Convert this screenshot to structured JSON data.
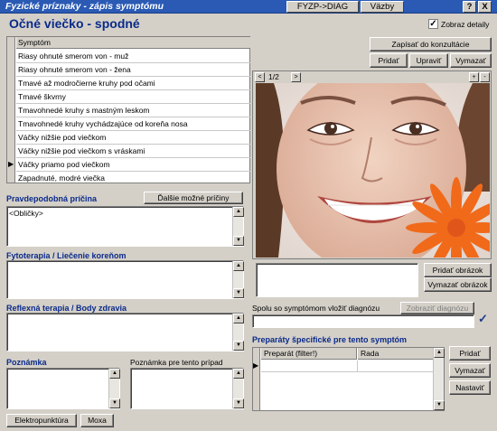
{
  "window": {
    "title": "Fyzické príznaky - zápis symptómu",
    "fyzp_diag_label": "FYZP->DIAG",
    "vazby_label": "Väzby",
    "help_label": "?",
    "close_label": "X"
  },
  "header": {
    "page_title": "Očné viečko - spodné",
    "show_details_label": "Zobraz detaily",
    "show_details_checked": true
  },
  "symptoms": {
    "column_header": "Symptóm",
    "rows": [
      "Riasy ohnuté smerom von - muž",
      "Riasy ohnuté smerom von - žena",
      "Tmavé až modročierne kruhy pod očami",
      "Tmavé škvrny",
      "Tmavohnedé kruhy s mastným leskom",
      "Tmavohnedé kruhy vychádzajúce od koreňa nosa",
      "Váčky nižšie pod viečkom",
      "Váčky nižšie pod viečkom s vráskami",
      "Váčky priamo pod viečkom",
      "Zapadnuté, modré viečka"
    ],
    "selected_index": 8
  },
  "actions": {
    "write_to_consultation": "Zapísať do konzultácie",
    "add": "Pridať",
    "edit": "Upraviť",
    "delete": "Vymazať"
  },
  "photo": {
    "counter": "1/2",
    "prev": "<",
    "next": ">",
    "zoom_in": "+",
    "zoom_out": "-",
    "add_image": "Pridať obrázok",
    "delete_image": "Vymazať obrázok"
  },
  "probable_cause": {
    "label": "Pravdepodobná príčina",
    "more_causes_button": "Ďalšie možné príčiny",
    "value": "<Obličky>"
  },
  "phytotherapy": {
    "label": "Fytoterapia / Liečenie koreňom",
    "value": ""
  },
  "reflex": {
    "label": "Reflexná terapia / Body zdravia",
    "value": ""
  },
  "note": {
    "label": "Poznámka",
    "value": ""
  },
  "case_note": {
    "label": "Poznámka pre tento prípad",
    "value": ""
  },
  "bottom_buttons": {
    "elektropunktura": "Elektropunktúra",
    "moxa": "Moxa"
  },
  "diagnosis": {
    "label": "Spolu so symptómom vložiť diagnózu",
    "show_button": "Zobraziť diagnózu",
    "value": "",
    "checked": true
  },
  "preparations": {
    "label": "Preparáty špecifické pre tento symptóm",
    "col_preparat": "Preparát (filter!)",
    "col_rada": "Rada",
    "add": "Pridať",
    "delete": "Vymazať",
    "set": "Nastaviť"
  }
}
